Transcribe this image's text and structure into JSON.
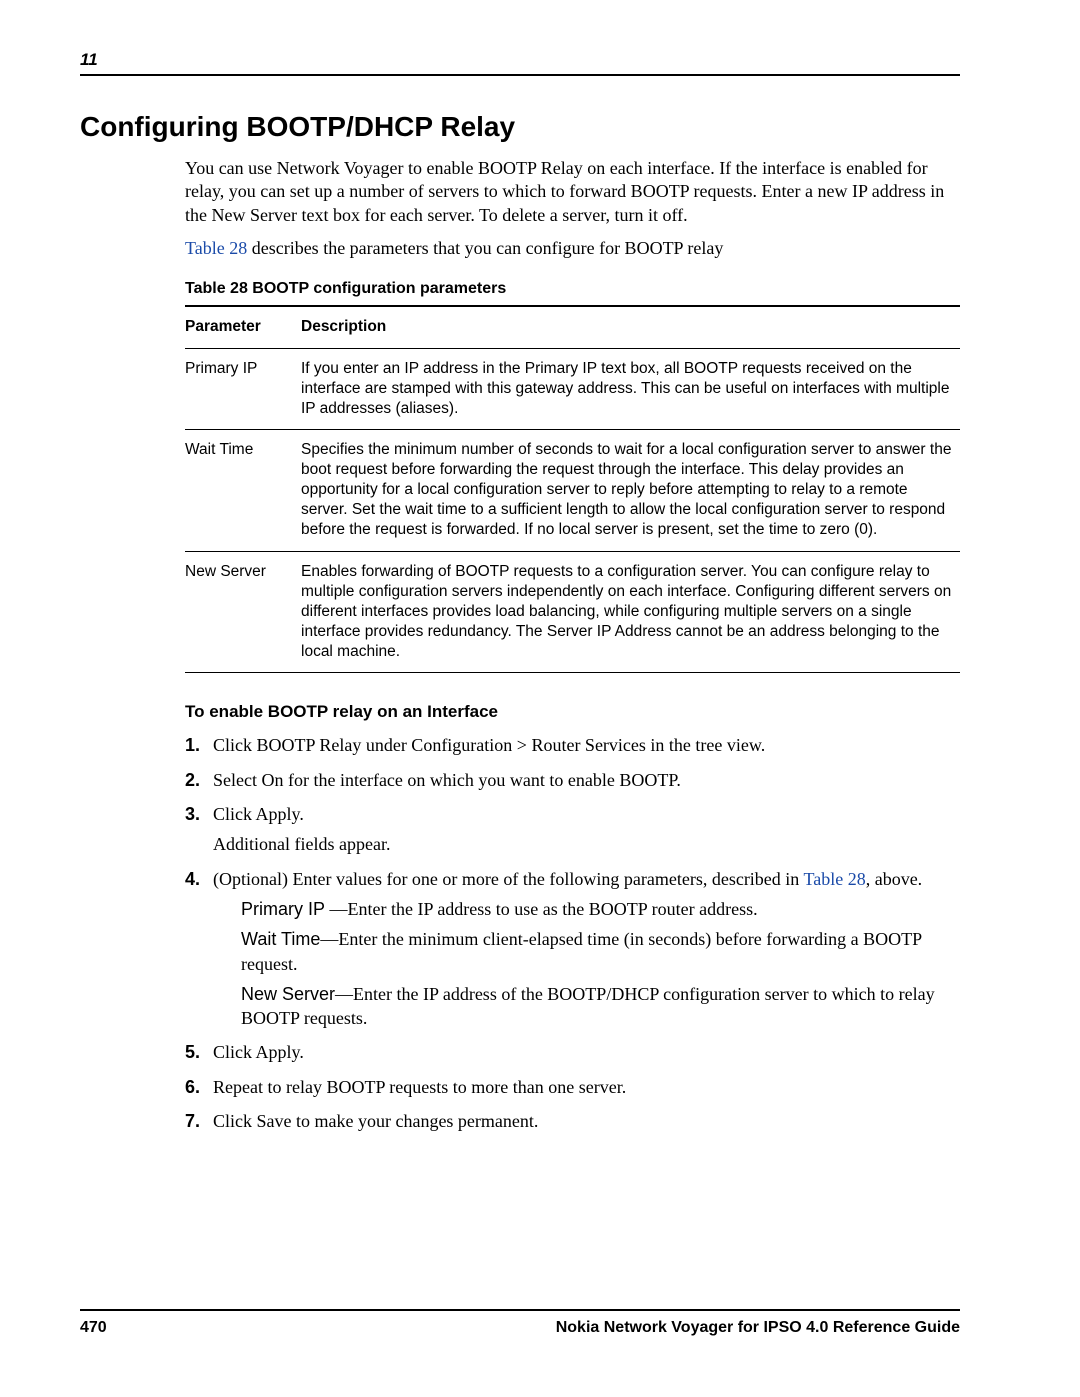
{
  "header": {
    "chapter_number": "11"
  },
  "section_title": "Configuring BOOTP/DHCP Relay",
  "intro": {
    "p1": "You can use Network Voyager to enable BOOTP Relay on each interface. If the interface is enabled for relay, you can set up a number of servers to which to forward BOOTP requests. Enter a new IP address in the New Server text box for each server. To delete a server, turn it off.",
    "table_ref": "Table 28",
    "p2_after_ref": " describes the parameters that you can configure for BOOTP relay"
  },
  "table": {
    "caption": "Table 28  BOOTP configuration parameters",
    "head": {
      "param": "Parameter",
      "desc": "Description"
    },
    "rows": [
      {
        "param": "Primary IP",
        "desc": "If you enter an IP address in the Primary IP text box, all BOOTP requests received on the interface are stamped with this gateway address. This can be useful on interfaces with multiple IP addresses (aliases)."
      },
      {
        "param": "Wait Time",
        "desc": "Specifies the minimum number of seconds to wait for a local configuration server to answer the boot request before forwarding the request through the interface. This delay provides an opportunity for a local configuration server to reply before attempting to relay to a remote server. Set the wait time to a sufficient length to allow the local configuration server to respond before the request is forwarded. If no local server is present, set the time to zero (0)."
      },
      {
        "param": "New Server",
        "desc": "Enables forwarding of BOOTP requests to a configuration server. You can configure relay to multiple configuration servers independently on each interface. Configuring different servers on different interfaces provides load balancing, while configuring multiple servers on a single interface provides redundancy. The Server IP Address cannot be an address belonging to the local machine."
      }
    ]
  },
  "procedure": {
    "heading": "To enable BOOTP relay on an Interface",
    "steps": {
      "s1": "Click BOOTP Relay under Configuration > Router Services in the tree view.",
      "s2": "Select On for the interface on which you want to enable BOOTP.",
      "s3": "Click Apply.",
      "s3_extra": "Additional fields appear.",
      "s4_pre": "(Optional) Enter values for one or more of the following parameters, described in ",
      "s4_link": "Table 28",
      "s4_post": ", above.",
      "s4_sub": {
        "a_label": "Primary IP",
        "a_sep": " —",
        "a_text": "Enter the IP address to use as the BOOTP router address.",
        "b_label": "Wait Time",
        "b_sep": "—",
        "b_text": "Enter the minimum client-elapsed time (in seconds) before forwarding a BOOTP request.",
        "c_label": "New Server",
        "c_sep": "—",
        "c_text": "Enter the IP address of the BOOTP/DHCP configuration server to which to relay BOOTP requests."
      },
      "s5": "Click Apply.",
      "s6": "Repeat to relay BOOTP requests to more than one server.",
      "s7": "Click Save to make your changes permanent."
    },
    "nums": {
      "n1": "1.",
      "n2": "2.",
      "n3": "3.",
      "n4": "4.",
      "n5": "5.",
      "n6": "6.",
      "n7": "7."
    }
  },
  "footer": {
    "page_number": "470",
    "doc_title": "Nokia Network Voyager for IPSO 4.0 Reference Guide"
  }
}
